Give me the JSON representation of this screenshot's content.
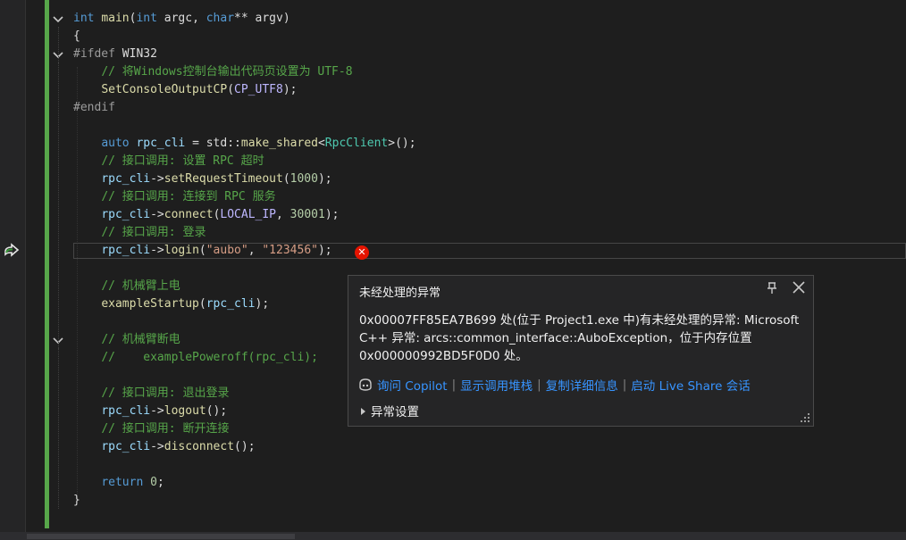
{
  "editor": {
    "lines": [
      [
        {
          "t": "int",
          "c": "kw"
        },
        {
          "t": " "
        },
        {
          "t": "main",
          "c": "fn"
        },
        {
          "t": "("
        },
        {
          "t": "int",
          "c": "kw"
        },
        {
          "t": " argc, "
        },
        {
          "t": "char",
          "c": "kw"
        },
        {
          "t": "** argv)"
        }
      ],
      [
        {
          "t": "{"
        }
      ],
      [
        {
          "t": "#ifdef",
          "c": "pp"
        },
        {
          "t": " WIN32"
        }
      ],
      [
        {
          "t": "    "
        },
        {
          "t": "// 将Windows控制台输出代码页设置为 UTF-8",
          "c": "cm"
        }
      ],
      [
        {
          "t": "    "
        },
        {
          "t": "SetConsoleOutputCP",
          "c": "fn"
        },
        {
          "t": "("
        },
        {
          "t": "CP_UTF8",
          "c": "mac"
        },
        {
          "t": ");"
        }
      ],
      [
        {
          "t": "#endif",
          "c": "pp"
        }
      ],
      [
        {
          "t": ""
        }
      ],
      [
        {
          "t": "    "
        },
        {
          "t": "auto",
          "c": "kw"
        },
        {
          "t": " "
        },
        {
          "t": "rpc_cli",
          "c": "var"
        },
        {
          "t": " = std::"
        },
        {
          "t": "make_shared",
          "c": "fn"
        },
        {
          "t": "<"
        },
        {
          "t": "RpcClient",
          "c": "ty"
        },
        {
          "t": ">();"
        }
      ],
      [
        {
          "t": "    "
        },
        {
          "t": "// 接口调用: 设置 RPC 超时",
          "c": "cm"
        }
      ],
      [
        {
          "t": "    "
        },
        {
          "t": "rpc_cli",
          "c": "var"
        },
        {
          "t": "->"
        },
        {
          "t": "setRequestTimeout",
          "c": "fn"
        },
        {
          "t": "("
        },
        {
          "t": "1000",
          "c": "nm"
        },
        {
          "t": ");"
        }
      ],
      [
        {
          "t": "    "
        },
        {
          "t": "// 接口调用: 连接到 RPC 服务",
          "c": "cm"
        }
      ],
      [
        {
          "t": "    "
        },
        {
          "t": "rpc_cli",
          "c": "var"
        },
        {
          "t": "->"
        },
        {
          "t": "connect",
          "c": "fn"
        },
        {
          "t": "("
        },
        {
          "t": "LOCAL_IP",
          "c": "mac"
        },
        {
          "t": ", "
        },
        {
          "t": "30001",
          "c": "nm"
        },
        {
          "t": ");"
        }
      ],
      [
        {
          "t": "    "
        },
        {
          "t": "// 接口调用: 登录",
          "c": "cm"
        }
      ],
      [
        {
          "t": "    "
        },
        {
          "t": "rpc_cli",
          "c": "var"
        },
        {
          "t": "->"
        },
        {
          "t": "login",
          "c": "fn"
        },
        {
          "t": "("
        },
        {
          "t": "\"aubo\"",
          "c": "st"
        },
        {
          "t": ", "
        },
        {
          "t": "\"123456\"",
          "c": "st"
        },
        {
          "t": ");"
        }
      ],
      [
        {
          "t": ""
        }
      ],
      [
        {
          "t": "    "
        },
        {
          "t": "// 机械臂上电",
          "c": "cm"
        }
      ],
      [
        {
          "t": "    "
        },
        {
          "t": "exampleStartup",
          "c": "fn"
        },
        {
          "t": "("
        },
        {
          "t": "rpc_cli",
          "c": "var"
        },
        {
          "t": ");"
        }
      ],
      [
        {
          "t": ""
        }
      ],
      [
        {
          "t": "    "
        },
        {
          "t": "// 机械臂断电",
          "c": "cm"
        }
      ],
      [
        {
          "t": "    "
        },
        {
          "t": "//    examplePoweroff(rpc_cli);",
          "c": "cm"
        }
      ],
      [
        {
          "t": ""
        }
      ],
      [
        {
          "t": "    "
        },
        {
          "t": "// 接口调用: 退出登录",
          "c": "cm"
        }
      ],
      [
        {
          "t": "    "
        },
        {
          "t": "rpc_cli",
          "c": "var"
        },
        {
          "t": "->"
        },
        {
          "t": "logout",
          "c": "fn"
        },
        {
          "t": "();"
        }
      ],
      [
        {
          "t": "    "
        },
        {
          "t": "// 接口调用: 断开连接",
          "c": "cm"
        }
      ],
      [
        {
          "t": "    "
        },
        {
          "t": "rpc_cli",
          "c": "var"
        },
        {
          "t": "->"
        },
        {
          "t": "disconnect",
          "c": "fn"
        },
        {
          "t": "();"
        }
      ],
      [
        {
          "t": ""
        }
      ],
      [
        {
          "t": "    "
        },
        {
          "t": "return",
          "c": "kw"
        },
        {
          "t": " "
        },
        {
          "t": "0",
          "c": "nm"
        },
        {
          "t": ";"
        }
      ],
      [
        {
          "t": "}"
        }
      ]
    ]
  },
  "exception_popup": {
    "title": "未经处理的异常",
    "message": "0x00007FF85EA7B699 处(位于 Project1.exe 中)有未经处理的异常: Microsoft C++ 异常: arcs::common_interface::AuboException，位于内存位置 0x000000992BD5F0D0 处。",
    "links": [
      "询问 Copilot",
      "显示调用堆栈",
      "复制详细信息",
      "启动 Live Share 会话"
    ],
    "exception_settings": "异常设置"
  },
  "icons": {
    "execution": "current-statement-arrow-icon",
    "error": "error-icon",
    "pin": "pin-icon",
    "close": "close-icon",
    "copilot": "copilot-icon"
  },
  "colors": {
    "background": "#1e1e1e",
    "change_bar": "#57a64a",
    "link": "#3794ff",
    "error": "#e51400"
  }
}
